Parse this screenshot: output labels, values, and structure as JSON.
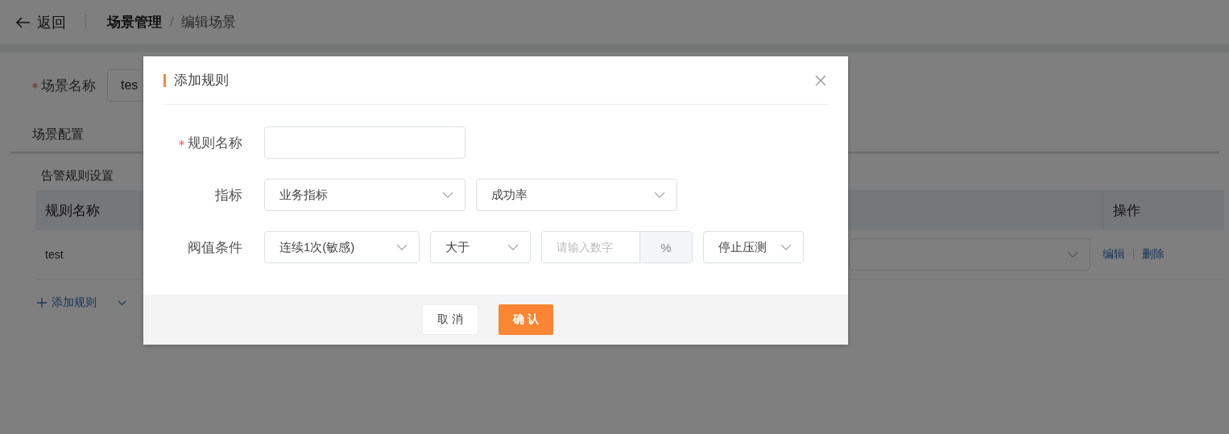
{
  "header": {
    "back": "返回",
    "separator": "/",
    "breadcrumb": [
      {
        "label": "场景管理",
        "current": false
      },
      {
        "label": "编辑场景",
        "current": true
      }
    ]
  },
  "scene_name": {
    "label": "场景名称",
    "required": true,
    "value": "tes"
  },
  "section_title": "场景配置",
  "alert_rules": {
    "title": "告警规则设置",
    "columns": [
      "规则名称",
      "操作"
    ],
    "rows": [
      {
        "name": "test",
        "actions": [
          "编辑",
          "删除"
        ]
      }
    ],
    "add_button": "添加规则"
  },
  "dialog": {
    "title": "添加规则",
    "fields": [
      {
        "label": "规则名称",
        "required": true,
        "controls": [
          {
            "kind": "text"
          }
        ]
      },
      {
        "label": "指标",
        "required": false,
        "controls": [
          {
            "kind": "select",
            "value": "业务指标"
          },
          {
            "kind": "select",
            "value": "成功率"
          }
        ]
      },
      {
        "label": "阀值条件",
        "required": false,
        "controls": [
          {
            "kind": "select",
            "value": "连续1次(敏感)"
          },
          {
            "kind": "select",
            "value": "大于"
          },
          {
            "kind": "number",
            "placeholder": "请输入数字",
            "suffix": "%"
          },
          {
            "kind": "select",
            "value": "停止压测"
          }
        ]
      }
    ],
    "buttons": [
      {
        "label": "取 消",
        "kind": "default"
      },
      {
        "label": "确 认",
        "kind": "primary"
      }
    ]
  }
}
